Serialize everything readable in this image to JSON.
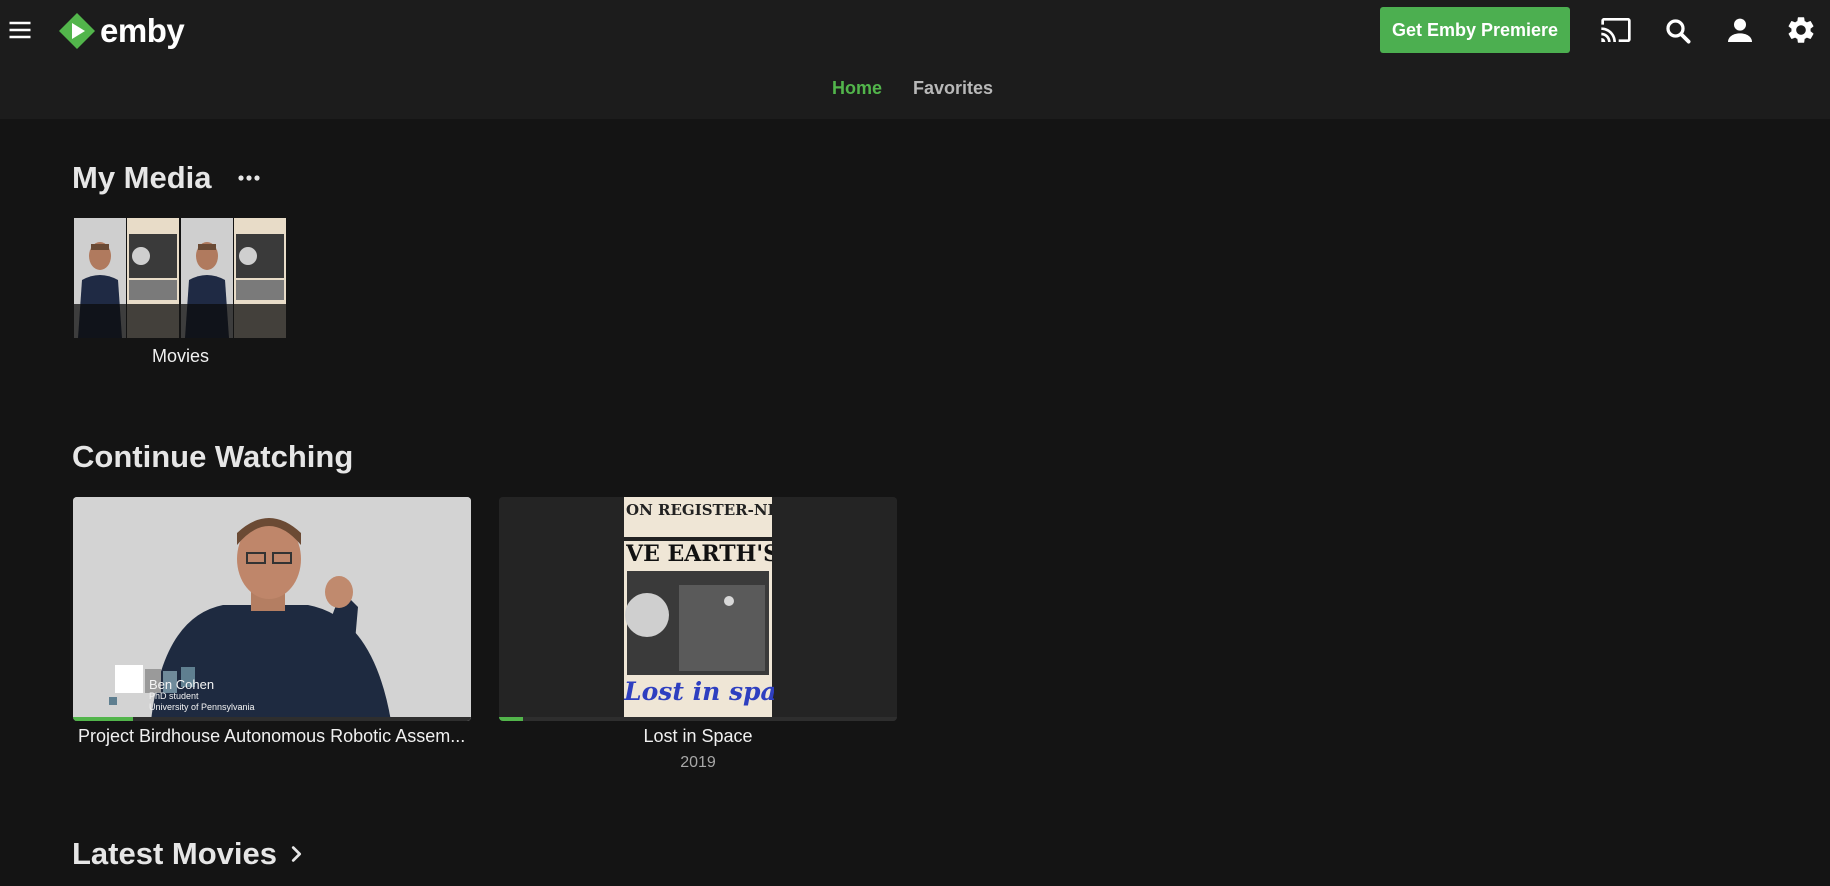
{
  "app": {
    "brand": "emby"
  },
  "header": {
    "premiere_label": "Get Emby Premiere",
    "icons": [
      "menu-icon",
      "cast-icon",
      "search-icon",
      "user-icon",
      "settings-icon"
    ]
  },
  "tabs": [
    {
      "label": "Home",
      "active": true
    },
    {
      "label": "Favorites",
      "active": false
    }
  ],
  "my_media": {
    "title": "My Media",
    "libraries": [
      {
        "label": "Movies"
      }
    ]
  },
  "continue_watching": {
    "title": "Continue Watching",
    "items": [
      {
        "title": "Project Birdhouse Autonomous Robotic Assem...",
        "overlay_name": "Ben Cohen",
        "overlay_role": "PhD student",
        "overlay_org": "University of Pennsylvania",
        "progress": 0.15
      },
      {
        "title": "Lost in Space",
        "year": "2019",
        "poster_headline": "ON REGISTER-NEWS",
        "poster_banner": "VE EARTH'S GRAV",
        "poster_caption": "Lost in space",
        "progress": 0.06
      }
    ]
  },
  "latest_movies": {
    "title": "Latest Movies"
  },
  "colors": {
    "accent": "#52b54b",
    "premiere_button": "#4caf50",
    "background": "#141414",
    "header": "#1c1c1c"
  }
}
